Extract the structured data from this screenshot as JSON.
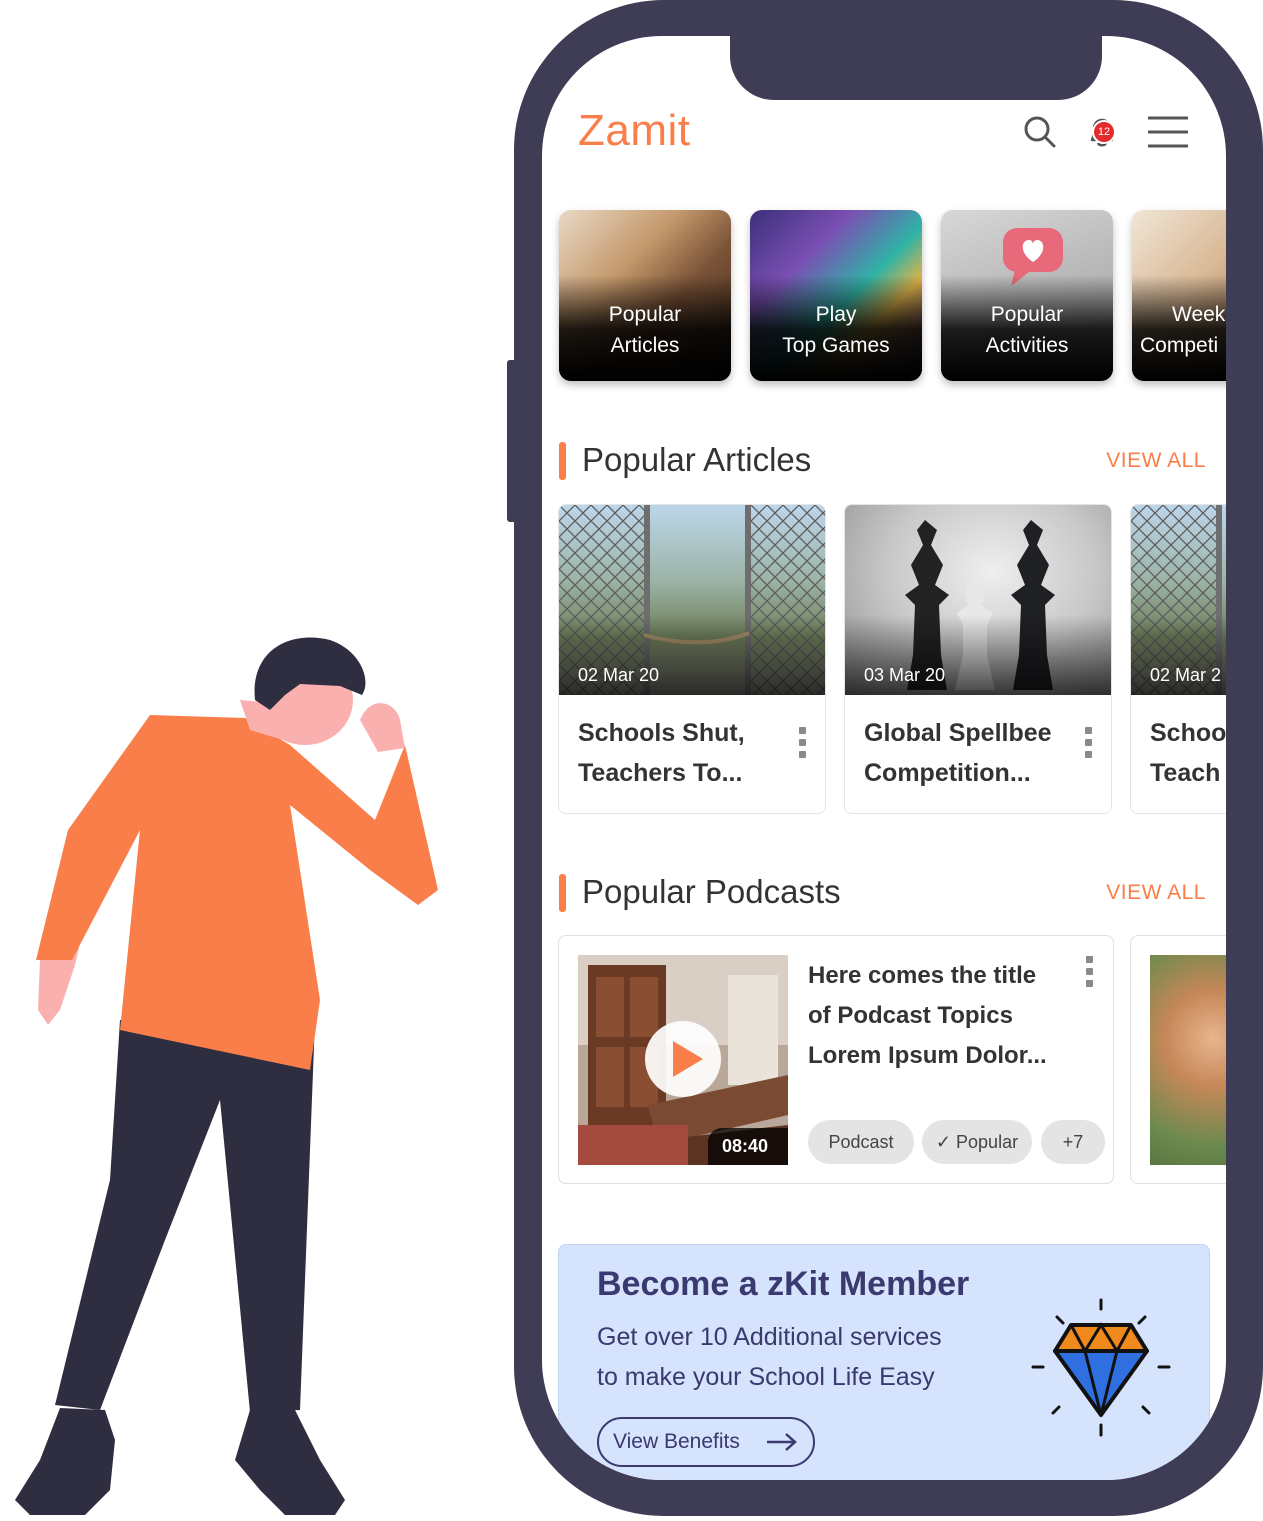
{
  "app": {
    "title": "Zamit",
    "notification_count": "12"
  },
  "categories": [
    {
      "line1": "Popular",
      "line2": "Articles"
    },
    {
      "line1": "Play",
      "line2": "Top Games"
    },
    {
      "line1": "Popular",
      "line2": "Activities"
    },
    {
      "line1": "Week",
      "line2": "Competi"
    }
  ],
  "articles_section": {
    "title": "Popular Articles",
    "view_all": "VIEW ALL",
    "items": [
      {
        "date": "02 Mar 20",
        "line1": "Schools Shut,",
        "line2": "Teachers To..."
      },
      {
        "date": "03 Mar 20",
        "line1": "Global Spellbee",
        "line2": "Competition..."
      },
      {
        "date": "02 Mar 2",
        "line1": "Schoo",
        "line2": "Teach"
      }
    ]
  },
  "podcasts_section": {
    "title": "Popular Podcasts",
    "view_all": "VIEW ALL",
    "item": {
      "duration": "08:40",
      "line1": "Here comes the title",
      "line2": "of Podcast Topics",
      "line3": "Lorem Ipsum Dolor...",
      "tags": [
        "Podcast",
        "Popular",
        "+7"
      ]
    }
  },
  "banner": {
    "title": "Become a zKit Member",
    "line1": "Get over 10 Additional services",
    "line2": "to make your School Life Easy",
    "button": "View Benefits"
  },
  "colors": {
    "accent": "#f97e4a",
    "phone": "#3f3d56",
    "banner_bg": "#d6e3fc",
    "banner_text": "#3a3970"
  }
}
